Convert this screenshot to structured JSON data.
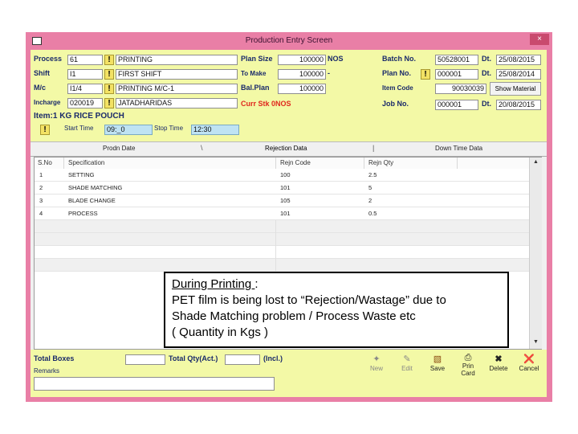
{
  "window": {
    "title": "Production Entry Screen",
    "close_label": "×"
  },
  "header": {
    "process_label": "Process",
    "process_code": "61",
    "process_name": "PRINTING",
    "shift_label": "Shift",
    "shift_code": "I1",
    "shift_name": "FIRST SHIFT",
    "mc_label": "M/c",
    "mc_code": "I1/4",
    "mc_name": "PRINTING M/C-1",
    "incharge_label": "Incharge",
    "incharge_code": "020019",
    "incharge_name": "JATADHARIDAS",
    "item_label": "Item:1 KG RICE POUCH",
    "start_time_label": "Start Time",
    "start_time": "09:_0",
    "stop_time_label": "Stop Time",
    "stop_time": "12:30",
    "plan_size_label": "Plan Size",
    "plan_size": "100000",
    "plan_size_unit": "NOS",
    "to_make_label": "To Make",
    "to_make": "100000",
    "to_make_unit": "-",
    "bal_plan_label": "Bal.Plan",
    "bal_plan": "100000",
    "curr_stk_label": "Curr Stk 0NOS",
    "batch_no_label": "Batch No.",
    "batch_no": "50528001",
    "batch_dt_label": "Dt.",
    "batch_dt": "25/08/2015",
    "plan_no_label": "Plan No.",
    "plan_no": "000001",
    "plan_dt_label": "Dt.",
    "plan_dt": "25/08/2014",
    "item_code_label": "Item Code",
    "item_code": "90030039",
    "show_material_label": "Show Material",
    "job_no_label": "Job No.",
    "job_no": "000001",
    "job_dt_label": "Dt.",
    "job_dt": "20/08/2015",
    "warn_glyph": "!"
  },
  "tabs": [
    "Prodn Date",
    "Rejection Data",
    "Down Time Data"
  ],
  "grid": {
    "columns": [
      "S.No",
      "Specification",
      "Rejn Code",
      "Rejn Qty"
    ],
    "rows": [
      {
        "sno": "1",
        "spec": "SETTING",
        "code": "100",
        "qty": "2.5"
      },
      {
        "sno": "2",
        "spec": "SHADE MATCHING",
        "code": "101",
        "qty": "5"
      },
      {
        "sno": "3",
        "spec": "BLADE CHANGE",
        "code": "105",
        "qty": "2"
      },
      {
        "sno": "4",
        "spec": "PROCESS",
        "code": "101",
        "qty": "0.5"
      }
    ]
  },
  "note": {
    "heading": "During Printing ",
    "colon": ":",
    "line1": "PET film is being lost to “Rejection/Wastage” due to",
    "line2": "Shade Matching problem / Process Waste etc",
    "line3": "( Quantity in Kgs )"
  },
  "footer": {
    "total_boxes_label": "Total Boxes",
    "total_qty_label": "Total Qty(Act.)",
    "incl_label": "(Incl.)",
    "remarks_label": "Remarks",
    "toolbar": {
      "new": "New",
      "edit": "Edit",
      "save": "Save",
      "print_card_1": "Prin",
      "print_card_2": "Card",
      "delete": "Delete",
      "cancel": "Cancel"
    }
  }
}
